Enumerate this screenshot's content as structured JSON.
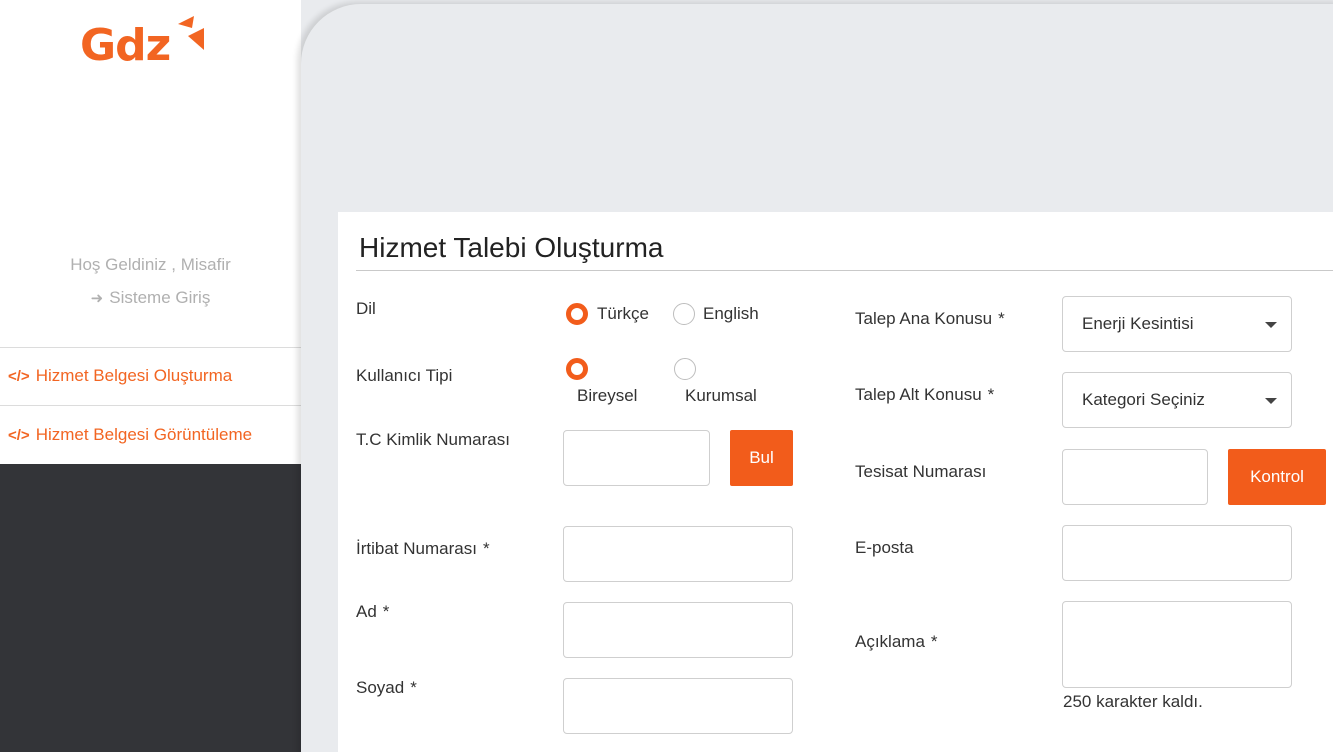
{
  "brand": {
    "logo_text": "Gdz",
    "color": "#f26522"
  },
  "sidebar": {
    "welcome": "Hoş Geldiniz , Misafir",
    "login_label": "Sisteme Giriş",
    "login_icon": "sign-in-icon",
    "items": [
      {
        "label": "Hizmet Belgesi Oluşturma",
        "icon": "code-icon"
      },
      {
        "label": "Hizmet Belgesi Görüntüleme",
        "icon": "code-icon"
      }
    ]
  },
  "form": {
    "title": "Hizmet Talebi Oluşturma",
    "language": {
      "label": "Dil",
      "options": [
        "Türkçe",
        "English"
      ],
      "selected": "Türkçe"
    },
    "user_type": {
      "label": "Kullanıcı Tipi",
      "options": [
        "Bireysel",
        "Kurumsal"
      ],
      "selected": "Bireysel"
    },
    "tc_label": "T.C Kimlik Numarası",
    "find_button": "Bul",
    "contact_label": "İrtibat Numarası",
    "name_label": "Ad",
    "surname_label": "Soyad",
    "required_mark": "*",
    "main_topic_label": "Talep Ana Konusu",
    "main_topic_value": "Enerji Kesintisi",
    "sub_topic_label": "Talep Alt Konusu",
    "sub_topic_value": "Kategori Seçiniz",
    "installation_label": "Tesisat Numarası",
    "check_button": "Kontrol",
    "email_label": "E-posta",
    "description_label": "Açıklama",
    "char_counter": "250 karakter kaldı."
  }
}
